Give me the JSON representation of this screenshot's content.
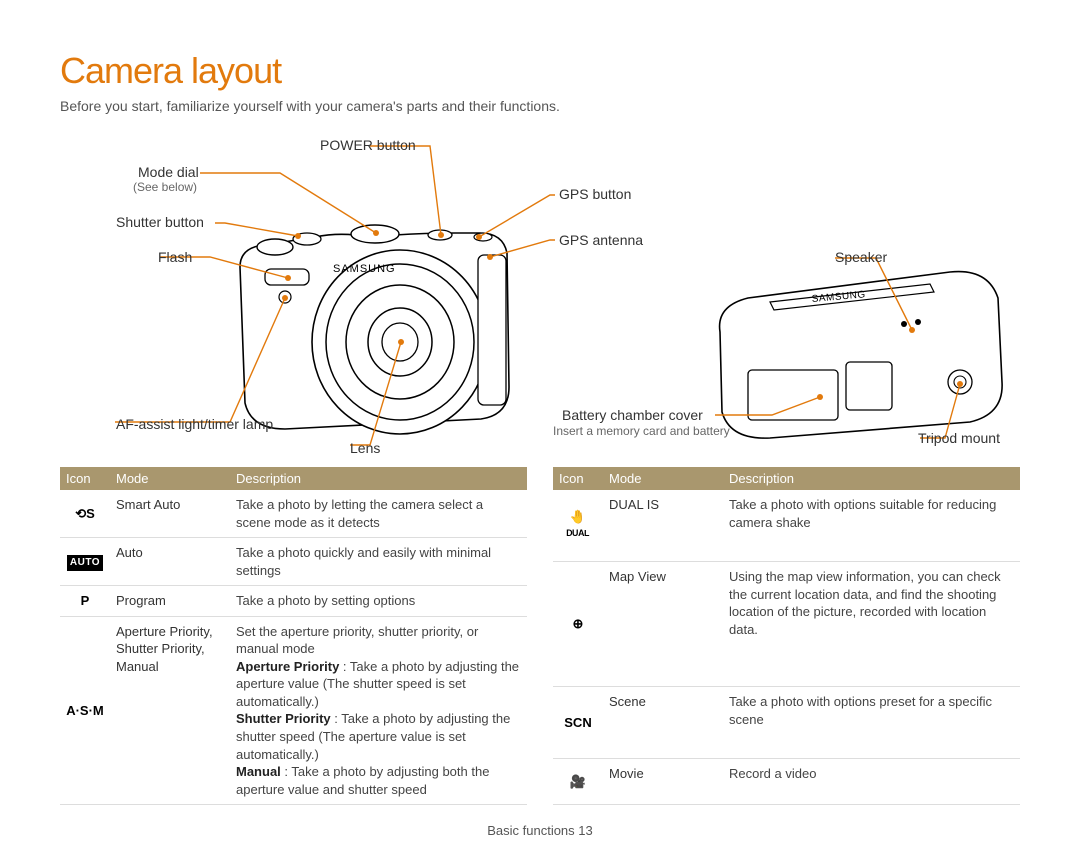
{
  "title": "Camera layout",
  "intro": "Before you start, familiarize yourself with your camera's parts and their functions.",
  "labels": {
    "power": "POWER button",
    "modeDial": "Mode dial",
    "modeDialSub": "(See below)",
    "shutter": "Shutter button",
    "flash": "Flash",
    "afAssist": "AF-assist light/timer lamp",
    "lens": "Lens",
    "gpsButton": "GPS button",
    "gpsAntenna": "GPS antenna",
    "speaker": "Speaker",
    "batteryCover": "Battery chamber cover",
    "batterySub": "Insert a memory card and battery",
    "tripod": "Tripod mount"
  },
  "table": {
    "headers": {
      "icon": "Icon",
      "mode": "Mode",
      "desc": "Description"
    }
  },
  "tableLeft": [
    {
      "icon": "⟲S",
      "mode": "Smart Auto",
      "desc": "Take a photo by letting the camera select a scene mode as it detects"
    },
    {
      "icon": "AUTO",
      "mode": "Auto",
      "desc": "Take a photo quickly and easily with minimal settings"
    },
    {
      "icon": "P",
      "mode": "Program",
      "desc": "Take a photo by setting options"
    },
    {
      "icon": "A·S·M",
      "mode": "Aperture Priority, Shutter Priority, Manual",
      "desc": "Set the aperture priority, shutter priority, or manual mode\nAperture Priority : Take a photo by adjusting the aperture value (The shutter speed is set automatically.)\nShutter Priority : Take a photo by adjusting the shutter speed (The aperture value is set automatically.)\nManual : Take a photo by adjusting both the aperture value and shutter speed"
    }
  ],
  "tableRight": [
    {
      "icon": "🤚ᴰᵁᴬᴸ",
      "mode": "DUAL IS",
      "desc": "Take a photo with options suitable for reducing camera shake"
    },
    {
      "icon": "⊕",
      "mode": "Map View",
      "desc": "Using the map view information, you can check the current location data, and find the shooting location of the picture, recorded with location data."
    },
    {
      "icon": "SCN",
      "mode": "Scene",
      "desc": "Take a photo with options preset for a specific scene"
    },
    {
      "icon": "🎥",
      "mode": "Movie",
      "desc": "Record a video"
    }
  ],
  "footer": "Basic functions  13"
}
